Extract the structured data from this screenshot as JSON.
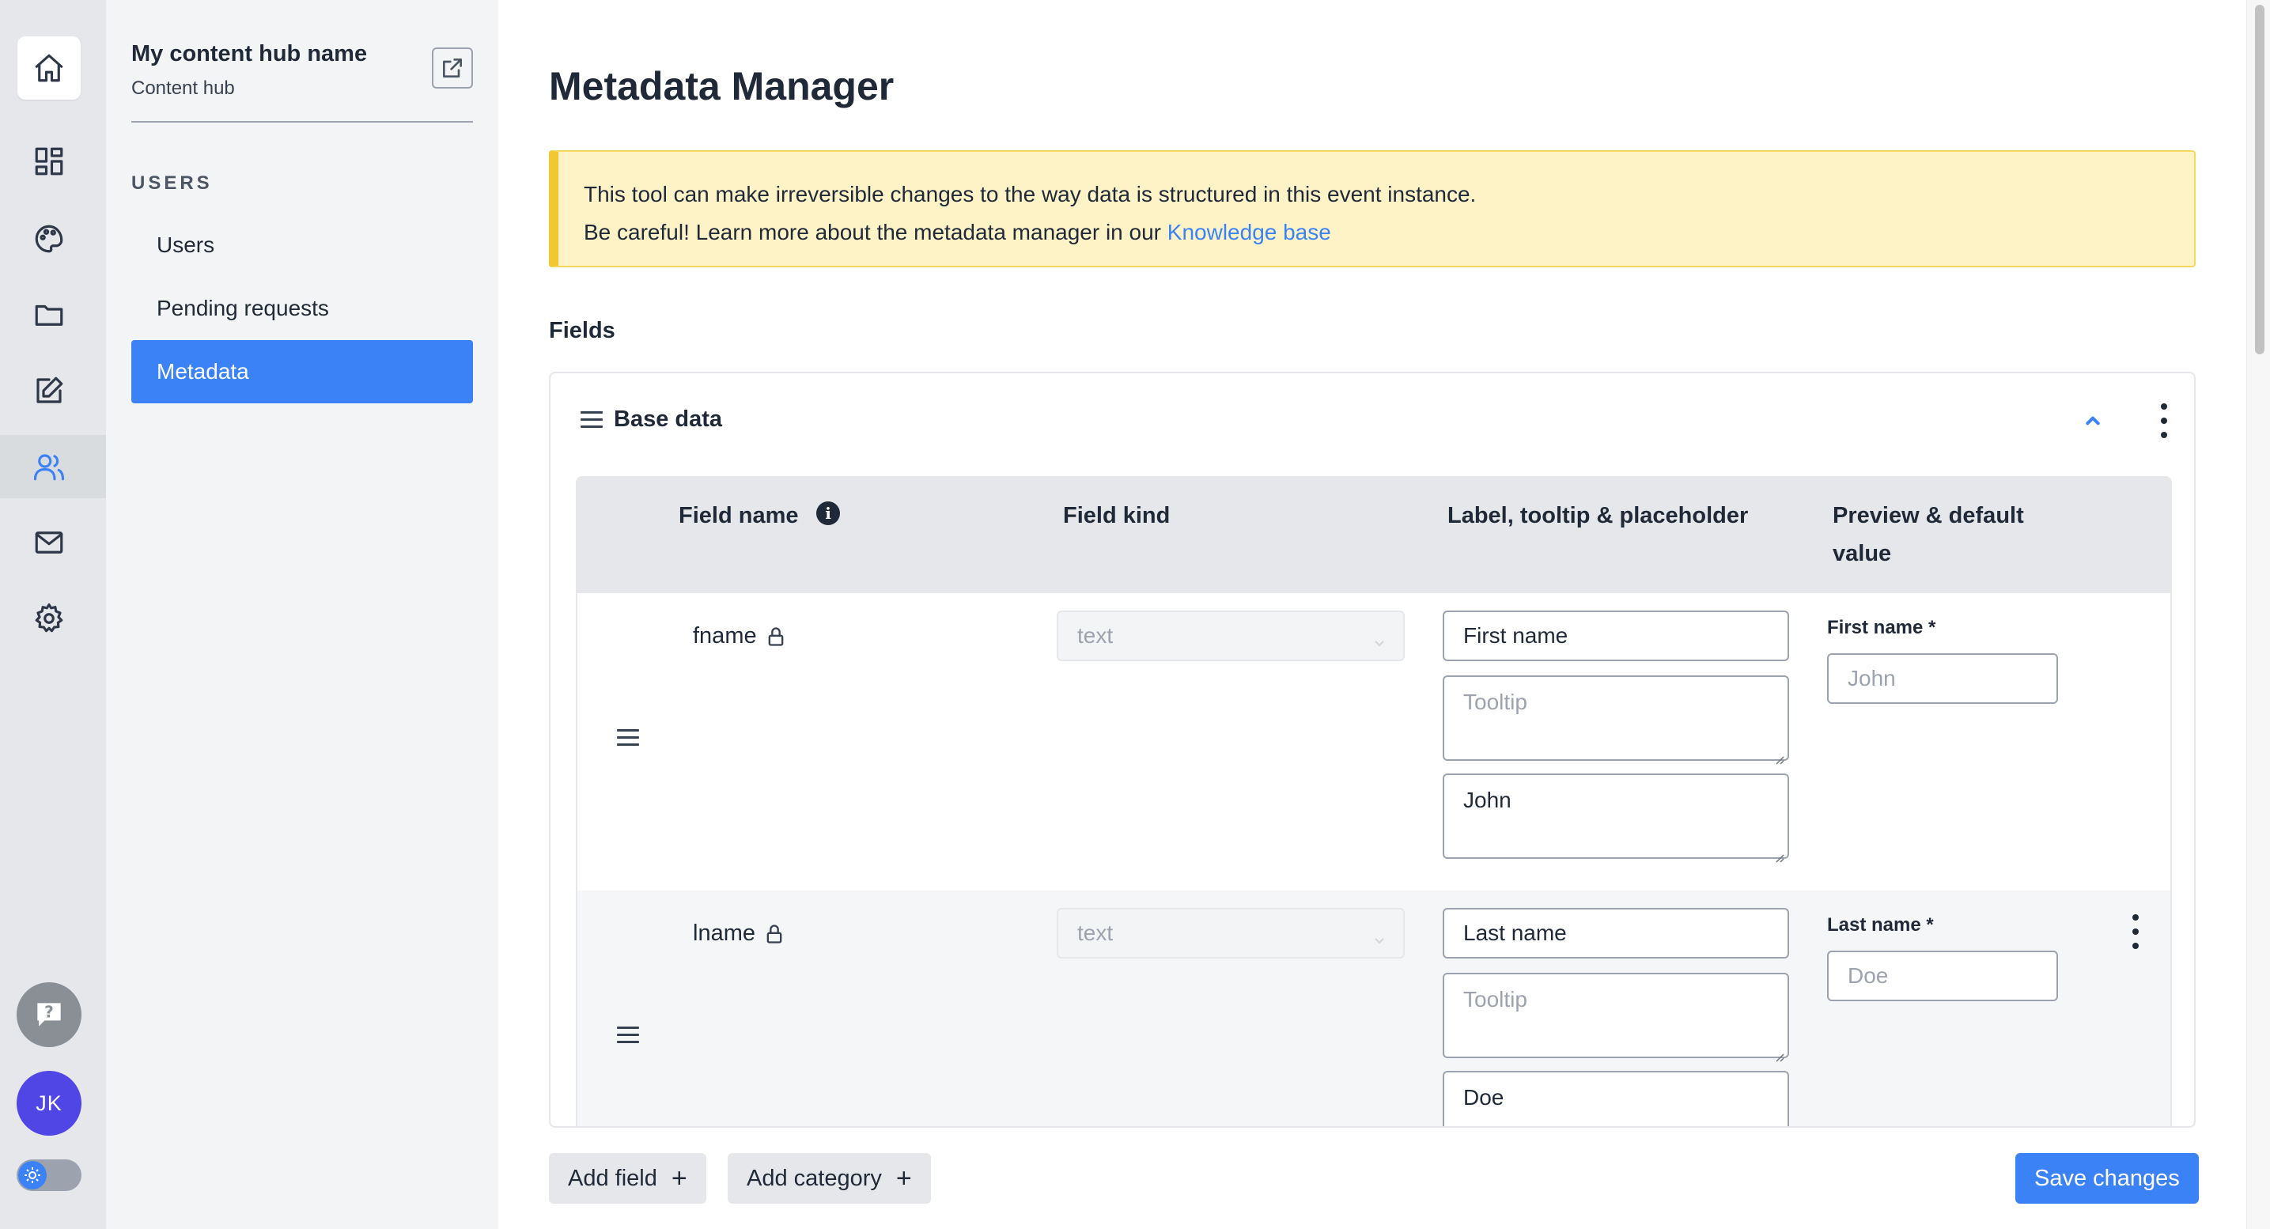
{
  "sidebar": {
    "hub_name": "My content hub name",
    "hub_subtitle": "Content hub",
    "section_label": "USERS",
    "items": [
      {
        "label": "Users",
        "active": false
      },
      {
        "label": "Pending requests",
        "active": false
      },
      {
        "label": "Metadata",
        "active": true
      }
    ]
  },
  "rail": {
    "icons": [
      "home-icon",
      "dashboard-icon",
      "palette-icon",
      "folder-icon",
      "edit-icon",
      "users-icon",
      "mail-icon",
      "settings-icon"
    ],
    "active_icon": "users-icon",
    "avatar_initials": "JK"
  },
  "page": {
    "title": "Metadata Manager",
    "warning_line1": "This tool can make irreversible changes to the way data is structured in this event instance.",
    "warning_line2_prefix": "Be careful! Learn more about the metadata manager in our ",
    "warning_link": "Knowledge base",
    "fields_label": "Fields"
  },
  "category": {
    "title": "Base data",
    "columns": {
      "field_name": "Field name",
      "field_kind": "Field kind",
      "label": "Label, tooltip & placeholder",
      "preview_line1": "Preview & default",
      "preview_line2": "value"
    },
    "rows": [
      {
        "field_name": "fname",
        "field_kind": "text",
        "label_value": "First name",
        "tooltip_placeholder": "Tooltip",
        "placeholder_value": "John",
        "preview_label": "First name *",
        "preview_placeholder": "John"
      },
      {
        "field_name": "lname",
        "field_kind": "text",
        "label_value": "Last name",
        "tooltip_placeholder": "Tooltip",
        "placeholder_value": "Doe",
        "preview_label": "Last name *",
        "preview_placeholder": "Doe"
      }
    ]
  },
  "footer": {
    "add_field": "Add field",
    "add_category": "Add category",
    "plus": "+",
    "save": "Save changes"
  },
  "colors": {
    "accent": "#3b82f6",
    "warning_bg": "#fdf3c7",
    "warning_border": "#f2c832",
    "avatar": "#4f46e5"
  }
}
